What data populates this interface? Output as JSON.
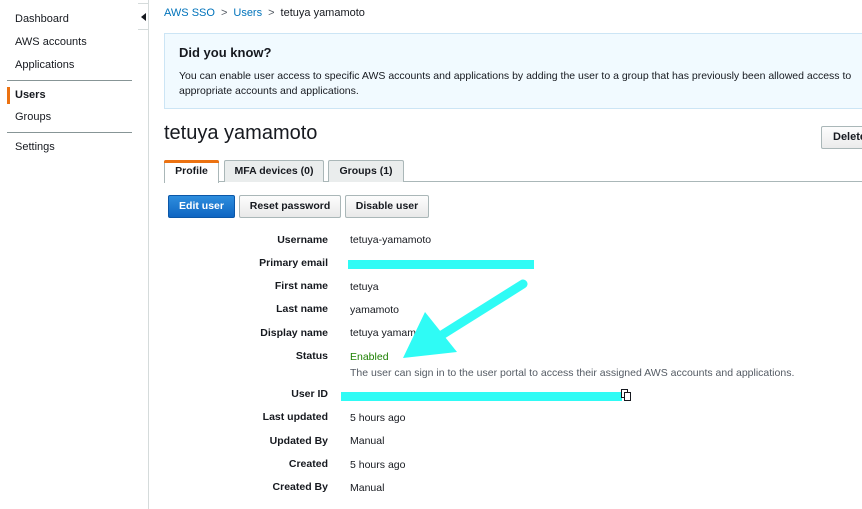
{
  "sidebar": {
    "items": [
      {
        "label": "Dashboard"
      },
      {
        "label": "AWS accounts"
      },
      {
        "label": "Applications"
      },
      {
        "label": "Users"
      },
      {
        "label": "Groups"
      },
      {
        "label": "Settings"
      }
    ],
    "active": "Users"
  },
  "breadcrumb": {
    "root": "AWS SSO",
    "parent": "Users",
    "current": "tetuya yamamoto",
    "separator": ">"
  },
  "banner": {
    "title": "Did you know?",
    "text": "You can enable user access to specific AWS accounts and applications by adding the user to a group that has previously been allowed access to appropriate accounts and applications."
  },
  "page": {
    "title": "tetuya yamamoto",
    "delete_label": "Delete"
  },
  "tabs": [
    {
      "label": "Profile"
    },
    {
      "label": "MFA devices (0)"
    },
    {
      "label": "Groups (1)"
    }
  ],
  "actions": {
    "edit": "Edit user",
    "reset": "Reset password",
    "disable": "Disable user"
  },
  "details": {
    "username_label": "Username",
    "username": "tetuya-yamamoto",
    "email_label": "Primary email",
    "first_name_label": "First name",
    "first_name": "tetuya",
    "last_name_label": "Last name",
    "last_name": "yamamoto",
    "display_name_label": "Display name",
    "display_name": "tetuya yamam",
    "status_label": "Status",
    "status": "Enabled",
    "status_note": "The user can sign in to the user portal to access their assigned AWS accounts and applications.",
    "user_id_label": "User ID",
    "last_updated_label": "Last updated",
    "last_updated": "5 hours ago",
    "updated_by_label": "Updated By",
    "updated_by": "Manual",
    "created_label": "Created",
    "created": "5 hours ago",
    "created_by_label": "Created By",
    "created_by": "Manual"
  },
  "colors": {
    "accent": "#ec7211",
    "link": "#0073bb",
    "primary_button": "#1166bb",
    "status_enabled": "#1d8102",
    "redaction": "#2ffbf5"
  },
  "icons": {
    "copy": "copy-icon",
    "collapse": "caret-left-icon"
  }
}
